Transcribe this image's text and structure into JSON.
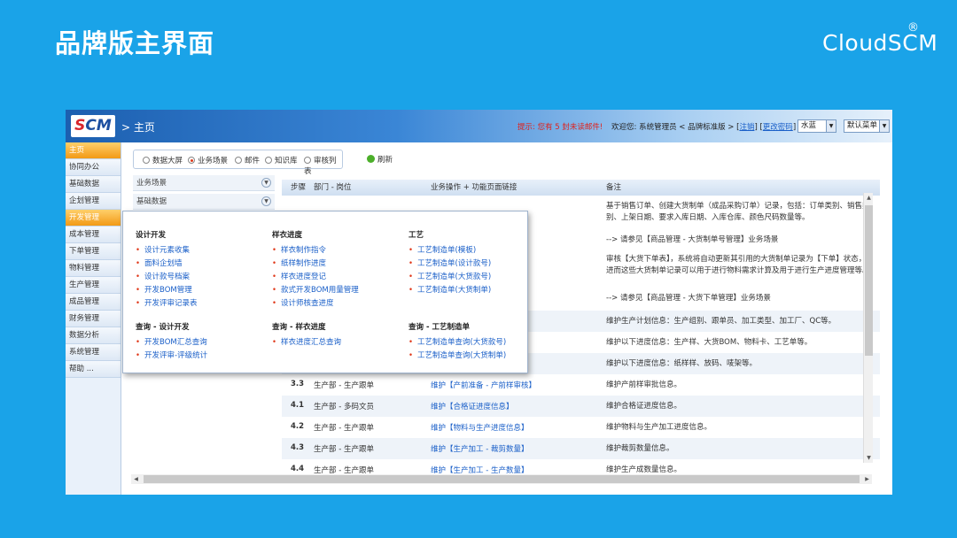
{
  "slide": {
    "title": "品牌版主界面",
    "brand": "CloudSCM",
    "brand_mark": "®"
  },
  "app": {
    "logo": "SCM",
    "breadcrumb": "> 主页",
    "hint": "提示: 您有 5 封未读邮件!",
    "welcome": "欢迎您: 系统管理员 < 品牌标准版 > [",
    "welcome_link1": "注销",
    "welcome_mid": "] [",
    "welcome_link2": "更改密码",
    "welcome_end": "]",
    "theme_select": "水蓝",
    "menu_select": "默认菜单"
  },
  "sidebar": {
    "items": [
      {
        "label": "主页"
      },
      {
        "label": "协同办公"
      },
      {
        "label": "基础数据"
      },
      {
        "label": "企划管理"
      },
      {
        "label": "开发管理"
      },
      {
        "label": "成本管理"
      },
      {
        "label": "下单管理"
      },
      {
        "label": "物料管理"
      },
      {
        "label": "生产管理"
      },
      {
        "label": "成品管理"
      },
      {
        "label": "财务管理"
      },
      {
        "label": "数据分析"
      },
      {
        "label": "系统管理"
      },
      {
        "label": "帮助 ..."
      }
    ]
  },
  "radios": {
    "options": [
      {
        "label": "数据大屏"
      },
      {
        "label": "业务场景"
      },
      {
        "label": "邮件"
      },
      {
        "label": "知识库"
      },
      {
        "label": "审核列表"
      }
    ],
    "refresh": "刷新"
  },
  "accordions": [
    {
      "label": "业务场景"
    },
    {
      "label": "基础数据"
    }
  ],
  "grid": {
    "headers": {
      "step": "步骤",
      "dept": "部门 - 岗位",
      "op": "业务操作 + 功能页面链接",
      "note": "备注"
    },
    "notes": {
      "n1": "基于销售订单、创建大货制单（成品采购订单）记录，包括：订单类别、销售类别、上架日期、要求入库日期、入库仓库、颜色尺码数量等。",
      "n2": "--> 请参见【商品管理 - 大货制单号管理】业务场景",
      "n3": "审核【大货下单表】，系统将自动更新其引用的大货制单记录为【下单】状态，进而这些大货制单记录可以用于进行物料需求计算及用于进行生产进度管理等。",
      "n4": "--> 请参见【商品管理 - 大货下单管理】业务场景",
      "n5": "维护生产计划信息：生产组别、跟单员、加工类型、加工厂、QC等。",
      "n6": "维护以下进度信息：生产样、大货BOM、物料卡、工艺单等。",
      "n7": "维护以下进度信息：纸样样、放码、唛架等。"
    },
    "rows": [
      {
        "step": "3.3",
        "dept": "生产部 - 生产跟单",
        "op": "维护【产前准备 - 产前样审核】",
        "note": "维护产前样审批信息。"
      },
      {
        "step": "4.1",
        "dept": "生产部 - 多码文员",
        "op": "维护【合格证进度信息】",
        "note": "维护合格证进度信息。"
      },
      {
        "step": "4.2",
        "dept": "生产部 - 生产跟单",
        "op": "维护【物料与生产进度信息】",
        "note": "维护物料与生产加工进度信息。"
      },
      {
        "step": "4.3",
        "dept": "生产部 - 生产跟单",
        "op": "维护【生产加工 - 裁剪数量】",
        "note": "维护裁剪数量信息。"
      },
      {
        "step": "4.4",
        "dept": "生产部 - 生产跟单",
        "op": "维护【生产加工 - 生产数量】",
        "note": "维护生产成数量信息。"
      }
    ]
  },
  "popup": {
    "columns": [
      {
        "title": "设计开发",
        "items": [
          "设计元素收集",
          "面料企划墙",
          "设计款号档案",
          "开发BOM管理",
          "开发评审记录表"
        ],
        "query_title": "查询 - 设计开发",
        "query_items": [
          "开发BOM汇总查询",
          "开发评审-评级统计"
        ]
      },
      {
        "title": "样衣进度",
        "items": [
          "样衣制作指令",
          "纸样制作进度",
          "样衣进度登记",
          "款式开发BOM用量管理",
          "设计师核查进度"
        ],
        "query_title": "查询 - 样衣进度",
        "query_items": [
          "样衣进度汇总查询"
        ]
      },
      {
        "title": "工艺",
        "items": [
          "工艺制造单(模板)",
          "工艺制造单(设计款号)",
          "工艺制造单(大货款号)",
          "工艺制造单(大货制单)"
        ],
        "query_title": "查询 - 工艺制造单",
        "query_items": [
          "工艺制造单查询(大货款号)",
          "工艺制造单查询(大货制单)"
        ]
      }
    ]
  }
}
